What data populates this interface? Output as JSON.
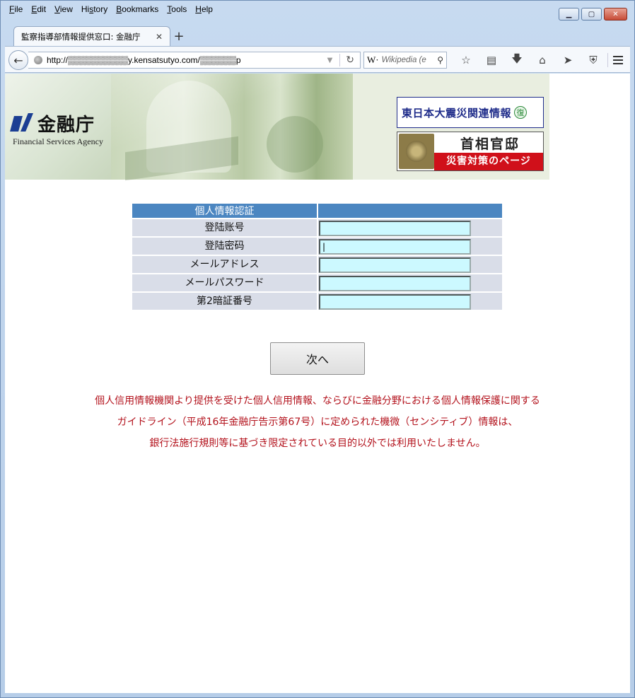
{
  "browser": {
    "menus": [
      {
        "label": "File",
        "u": "F",
        "rest": "ile"
      },
      {
        "label": "Edit",
        "u": "E",
        "rest": "dit"
      },
      {
        "label": "View",
        "u": "V",
        "rest": "iew"
      },
      {
        "label": "History",
        "pre": "Hi",
        "u": "s",
        "rest": "tory"
      },
      {
        "label": "Bookmarks",
        "u": "B",
        "rest": "ookmarks"
      },
      {
        "label": "Tools",
        "u": "T",
        "rest": "ools"
      },
      {
        "label": "Help",
        "u": "H",
        "rest": "elp"
      }
    ],
    "tab_title": "監察指導部情報提供窓口: 金融庁",
    "tab_close": "✕",
    "new_tab": "+",
    "url": "http://▒▒▒▒▒▒▒▒▒▒y.kensatsutyo.com/▒▒▒▒▒▒p",
    "search_engine": "W·",
    "search_placeholder": "Wikipedia (e",
    "toolbar_icons": [
      "star-icon",
      "reading-list-icon",
      "download-icon",
      "home-icon",
      "send-icon",
      "shield-icon"
    ],
    "window_buttons": {
      "minimize": "▁",
      "maximize": "▢",
      "close": "✕"
    }
  },
  "banner": {
    "logo_jp": "金融庁",
    "logo_en": "Financial Services Agency",
    "quake_link": "東日本大震災関連情報",
    "quake_badge": "復",
    "pm_title": "首相官邸",
    "pm_sub": "災害対策のページ"
  },
  "form": {
    "header": "個人情報認証",
    "fields": [
      {
        "label": "登陆账号",
        "value": ""
      },
      {
        "label": "登陆密码",
        "value": "|"
      },
      {
        "label": "メールアドレス",
        "value": ""
      },
      {
        "label": "メールパスワード",
        "value": ""
      },
      {
        "label": "第2暗証番号",
        "value": ""
      }
    ],
    "submit_label": "次へ"
  },
  "notice": {
    "line1": "個人信用情報機関より提供を受けた個人信用情報、ならびに金融分野における個人情報保護に関する",
    "line2": "ガイドライン（平成16年金融庁告示第67号）に定められた機微（センシティブ）情報は、",
    "line3": "銀行法施行規則等に基づき限定されている目的以外では利用いたしません。"
  },
  "colors": {
    "table_header": "#4b86c1",
    "table_cell": "#d9dde8",
    "input_bg": "#ccf9ff",
    "notice_text": "#b3121c",
    "quake_blue": "#1f2c8a",
    "pm_red": "#d0101a"
  }
}
